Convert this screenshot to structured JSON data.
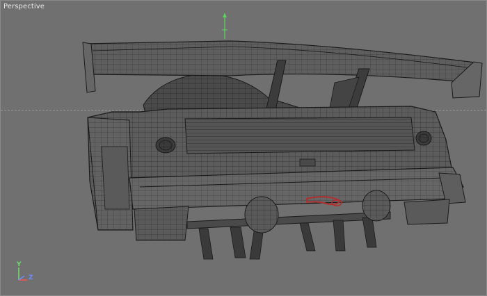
{
  "viewport": {
    "label": "Perspective",
    "background": "#707070",
    "wire_color": "#1a1a1a",
    "surface_color": "#5c5c5c"
  },
  "axis_gizmo": {
    "y_label": "Y",
    "z_label": "Z",
    "y_color": "#6fdc6f",
    "z_color": "#6a8cff",
    "x_color": "#ff5050"
  },
  "scene": {
    "object": "car-rear-wireframe-model"
  }
}
